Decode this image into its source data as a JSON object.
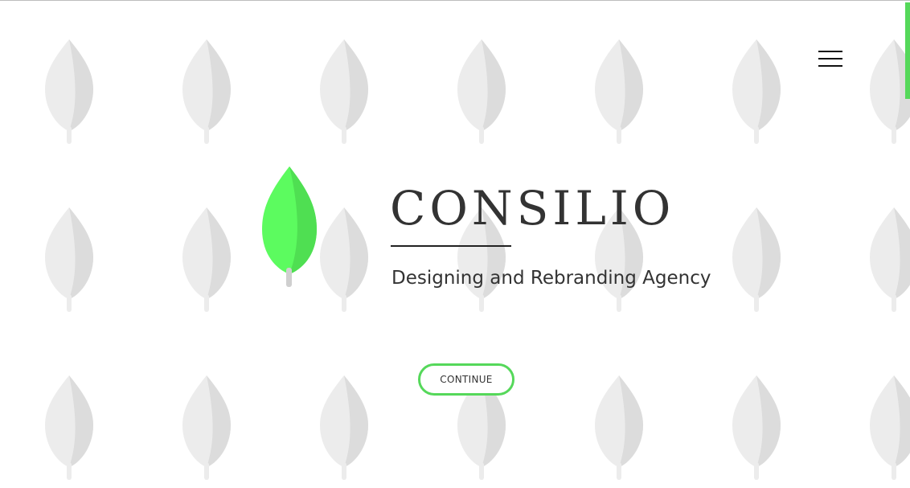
{
  "brand": {
    "name": "CONSILIO",
    "tagline": "Designing and Rebranding Agency",
    "logo_icon": "leaf-icon",
    "accent_color": "#55d85a"
  },
  "actions": {
    "continue_label": "CONTINUE"
  },
  "navigation": {
    "menu_icon": "hamburger-menu-icon"
  },
  "background": {
    "pattern_icon": "leaf-icon",
    "pattern_color": "#ececec",
    "pattern_shade_color": "#dcdcdc"
  }
}
